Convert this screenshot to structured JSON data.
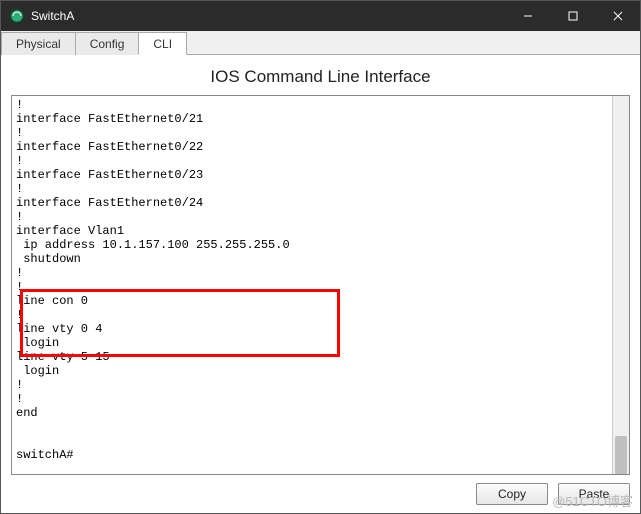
{
  "window": {
    "title": "SwitchA"
  },
  "tabs": {
    "physical": "Physical",
    "config": "Config",
    "cli": "CLI"
  },
  "cli": {
    "heading": "IOS Command Line Interface",
    "output": "!\ninterface FastEthernet0/21\n!\ninterface FastEthernet0/22\n!\ninterface FastEthernet0/23\n!\ninterface FastEthernet0/24\n!\ninterface Vlan1\n ip address 10.1.157.100 255.255.255.0\n shutdown\n!\n!\nline con 0\n!\nline vty 0 4\n login\nline vty 5 15\n login\n!\n!\nend\n\n\nswitchA#"
  },
  "buttons": {
    "copy": "Copy",
    "paste": "Paste"
  },
  "watermark": "@51CTO博客"
}
